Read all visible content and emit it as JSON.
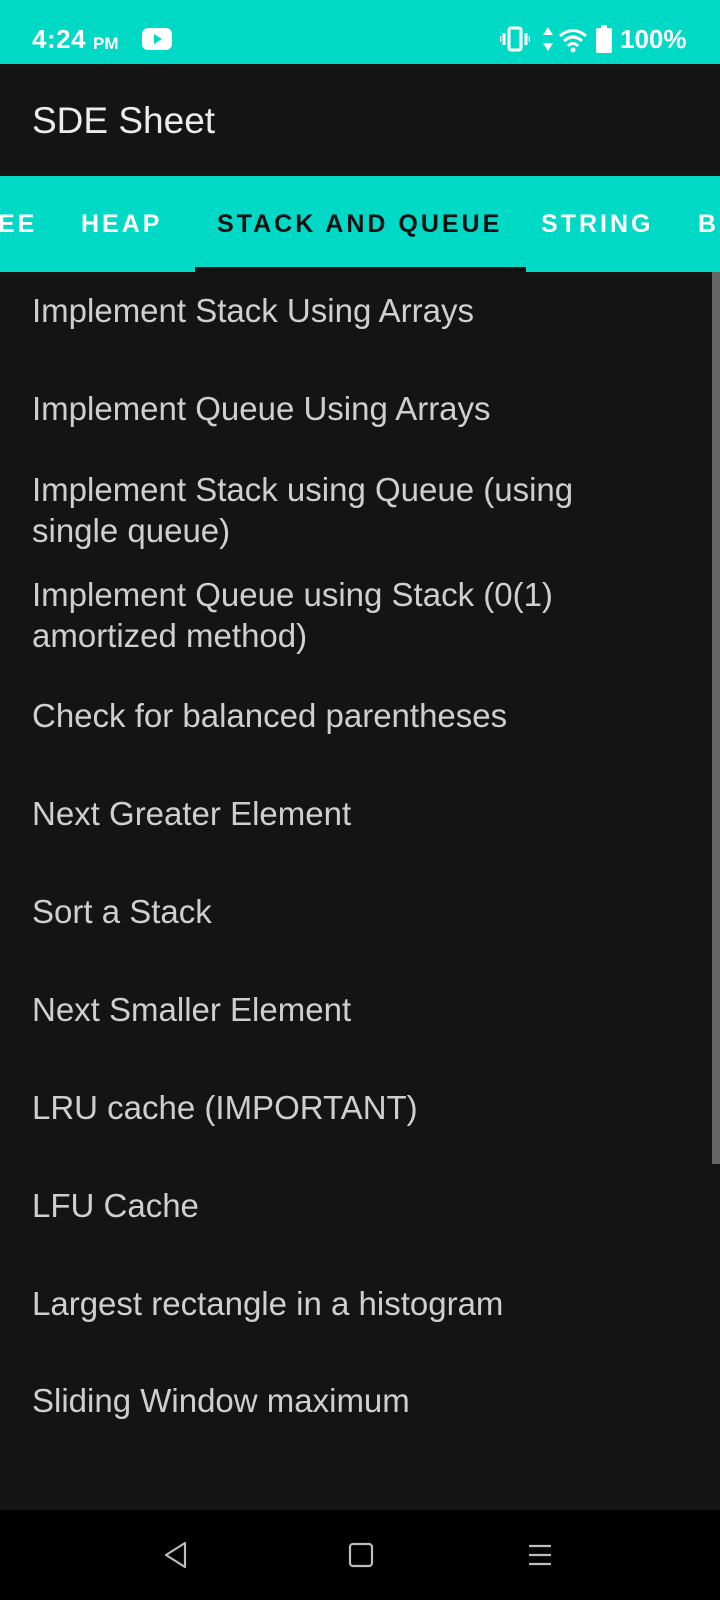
{
  "status_bar": {
    "time": "4:24",
    "ampm": "PM",
    "battery": "100%",
    "background": "#00d9c6",
    "icons": [
      "youtube-icon",
      "vibrate-icon",
      "data-icon",
      "wifi-icon",
      "battery-icon"
    ]
  },
  "app_bar": {
    "title": "SDE Sheet"
  },
  "tabs": [
    {
      "label": "EE",
      "active": false
    },
    {
      "label": "HEAP",
      "active": false
    },
    {
      "label": "STACK AND QUEUE",
      "active": true
    },
    {
      "label": "STRING",
      "active": false
    },
    {
      "label": "B",
      "active": false
    }
  ],
  "list": {
    "items": [
      {
        "line1": "Implement Stack Using Arrays"
      },
      {
        "line1": "Implement Queue Using Arrays"
      },
      {
        "line1": "Implement Stack using Queue (using",
        "line2": "single queue)"
      },
      {
        "line1": "Implement Queue using Stack (0(1)",
        "line2": "amortized method)"
      },
      {
        "line1": "Check for balanced parentheses"
      },
      {
        "line1": "Next Greater Element"
      },
      {
        "line1": "Sort a Stack"
      },
      {
        "line1": "Next Smaller Element"
      },
      {
        "line1": "LRU cache (IMPORTANT)"
      },
      {
        "line1": "LFU Cache"
      },
      {
        "line1": "Largest rectangle in a histogram"
      },
      {
        "line1": "Sliding Window maximum"
      }
    ]
  },
  "nav_bar": {
    "icons": [
      "back-icon",
      "home-icon",
      "recents-icon"
    ]
  }
}
